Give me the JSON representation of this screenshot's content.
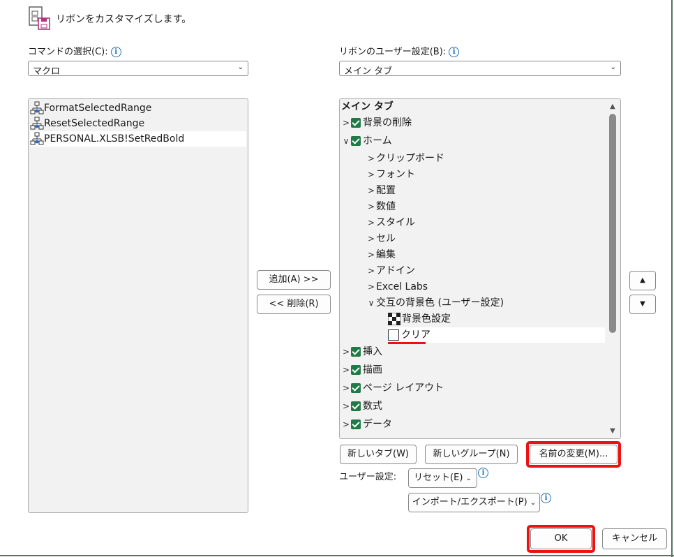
{
  "header": {
    "title": "リボンをカスタマイズします。"
  },
  "left": {
    "label": "コマンドの選択(C):",
    "select_value": "マクロ",
    "commands": [
      "FormatSelectedRange",
      "ResetSelectedRange",
      "PERSONAL.XLSB!SetRedBold"
    ]
  },
  "right": {
    "label": "リボンのユーザー設定(B):",
    "select_value": "メイン タブ",
    "tree_header": "メイン タブ",
    "tree": {
      "haikei_sakujo": "背景の削除",
      "home": "ホーム",
      "clipboard": "クリップボード",
      "font": "フォント",
      "haichi": "配置",
      "suuchi": "数値",
      "style": "スタイル",
      "cell": "セル",
      "henshu": "編集",
      "addin": "アドイン",
      "excel_labs": "Excel Labs",
      "koogo": "交互の背景色 (ユーザー設定)",
      "haikeiiro_settei": "背景色設定",
      "clear": "クリア",
      "sounyuu": "挿入",
      "byouga": "描画",
      "page_layout": "ページ レイアウト",
      "suushiki": "数式",
      "data": "データ"
    }
  },
  "buttons": {
    "add": "追加(A) >>",
    "remove": "<< 削除(R)",
    "new_tab": "新しいタブ(W)",
    "new_group": "新しいグループ(N)",
    "rename": "名前の変更(M)...",
    "user_settings_label": "ユーザー設定:",
    "reset": "リセット(E)",
    "import_export": "インポート/エクスポート(P)",
    "ok": "OK",
    "cancel": "キャンセル"
  },
  "colors": {
    "check_green": "#1f7a45",
    "highlight_red": "#ee1111",
    "info_blue": "#1f6fb5"
  }
}
